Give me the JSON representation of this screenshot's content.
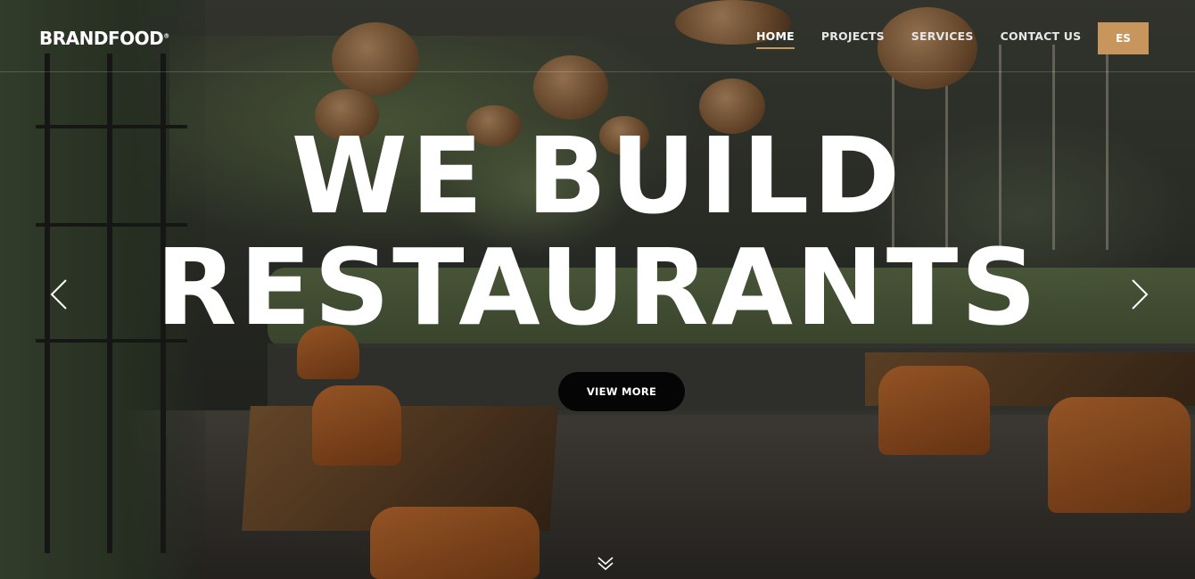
{
  "brand": {
    "name": "BRANDFOOD",
    "mark": "®"
  },
  "nav": {
    "items": [
      {
        "label": "HOME",
        "active": true
      },
      {
        "label": "PROJECTS",
        "active": false
      },
      {
        "label": "SERVICES",
        "active": false
      },
      {
        "label": "CONTACT US",
        "active": false
      }
    ],
    "language_button": "ES"
  },
  "hero": {
    "headline_line1": "WE BUILD",
    "headline_line2": "RESTAURANTS",
    "cta_label": "VIEW MORE",
    "prev_icon": "chevron-left-icon",
    "next_icon": "chevron-right-icon",
    "scroll_icon": "double-chevron-down-icon"
  },
  "colors": {
    "accent": "#c8955c",
    "cta_background": "#050505",
    "text": "#ffffff"
  }
}
